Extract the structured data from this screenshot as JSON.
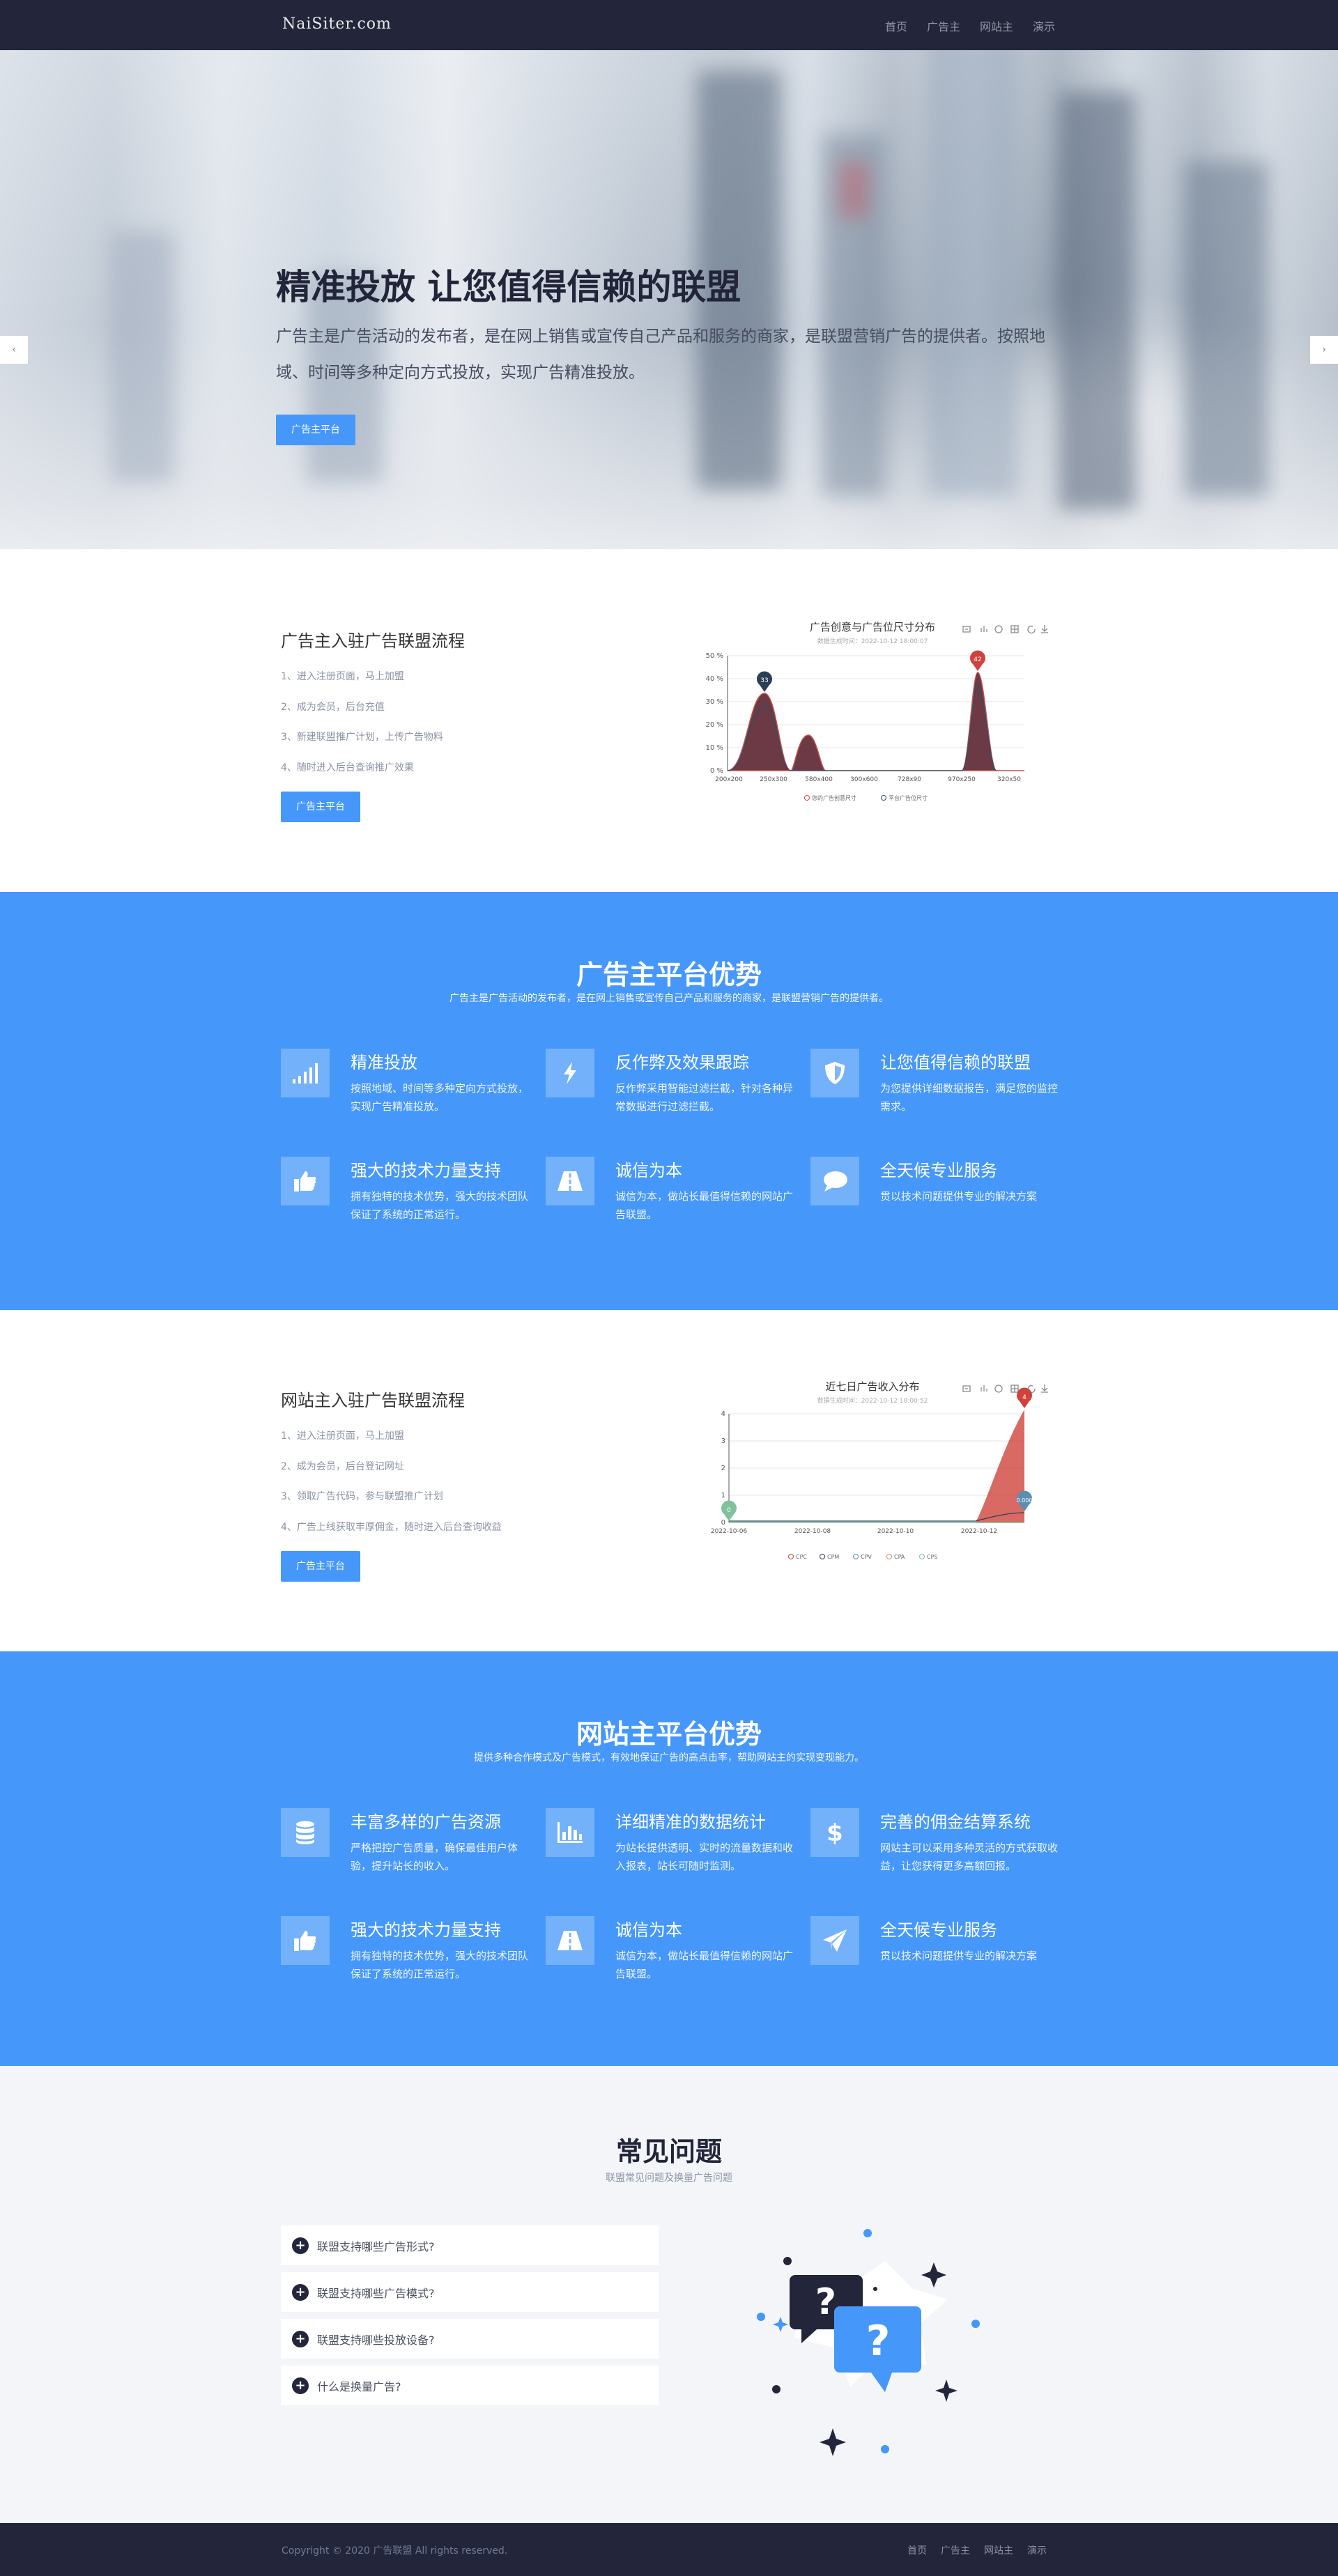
{
  "header": {
    "logo": "NaiSiter.com",
    "nav": [
      "首页",
      "广告主",
      "网站主",
      "演示"
    ]
  },
  "hero": {
    "title": "精准投放 让您值得信赖的联盟",
    "subtitle": "广告主是广告活动的发布者，是在网上销售或宣传自己产品和服务的商家，是联盟营销广告的提供者。按照地域、时间等多种定向方式投放，实现广告精准投放。",
    "button": "广告主平台",
    "prev_arrow": "‹",
    "next_arrow": "›",
    "slides": 4,
    "active_slide": 1
  },
  "advertiser_flow": {
    "title": "广告主入驻广告联盟流程",
    "steps": [
      "1、进入注册页面，马上加盟",
      "2、成为会员，后台充值",
      "3、新建联盟推广计划，上传广告物料",
      "4、随时进入后台查询推广效果"
    ],
    "button": "广告主平台"
  },
  "chart1": {
    "title": "广告创意与广告位尺寸分布",
    "subtitle": "数据生成时间：2022-10-12 18:00:07",
    "yticks": [
      "50 %",
      "40 %",
      "30 %",
      "20 %",
      "10 %",
      "0 %"
    ],
    "xticks": [
      "200x200",
      "250x300",
      "580x400",
      "300x600",
      "728x90",
      "970x250",
      "320x50"
    ],
    "legend": [
      "您的广告创意尺寸",
      "平台广告位尺寸"
    ],
    "markers": [
      "33",
      "42"
    ]
  },
  "advertiser_advantages": {
    "title": "广告主平台优势",
    "subtitle": "广告主是广告活动的发布者，是在网上销售或宣传自己产品和服务的商家，是联盟营销广告的提供者。",
    "items": [
      {
        "title": "精准投放",
        "text": "按照地域、时间等多种定向方式投放，实现广告精准投放。",
        "icon": "signal-bars-icon"
      },
      {
        "title": "反作弊及效果跟踪",
        "text": "反作弊采用智能过滤拦截，针对各种异常数据进行过滤拦截。",
        "icon": "lightning-icon"
      },
      {
        "title": "让您值得信赖的联盟",
        "text": "为您提供详细数据报告，满足您的监控需求。",
        "icon": "shield-icon"
      },
      {
        "title": "强大的技术力量支持",
        "text": "拥有独特的技术优势，强大的技术团队保证了系统的正常运行。",
        "icon": "thumbs-up-icon"
      },
      {
        "title": "诚信为本",
        "text": "诚信为本，做站长最值得信赖的网站广告联盟。",
        "icon": "road-icon"
      },
      {
        "title": "全天候专业服务",
        "text": "贯以技术问题提供专业的解决方案",
        "icon": "chat-bubble-icon"
      }
    ]
  },
  "publisher_flow": {
    "title": "网站主入驻广告联盟流程",
    "steps": [
      "1、进入注册页面，马上加盟",
      "2、成为会员，后台登记网址",
      "3、领取广告代码，参与联盟推广计划",
      "4、广告上线获取丰厚佣金，随时进入后台查询收益"
    ],
    "button": "广告主平台"
  },
  "chart2": {
    "title": "近七日广告收入分布",
    "subtitle": "数据生成时间：2022-10-12 18:00:52",
    "yticks": [
      "4",
      "3",
      "2",
      "1",
      "0"
    ],
    "xticks": [
      "2022-10-06",
      "2022-10-08",
      "2022-10-10",
      "2022-10-12"
    ],
    "legend": [
      "CPC",
      "CPM",
      "CPV",
      "CPA",
      "CPS"
    ],
    "markers": [
      "4",
      "0",
      "0.000"
    ]
  },
  "publisher_advantages": {
    "title": "网站主平台优势",
    "subtitle": "提供多种合作模式及广告模式，有效地保证广告的高点击率，帮助网站主的实现变现能力。",
    "items": [
      {
        "title": "丰富多样的广告资源",
        "text": "严格把控广告质量，确保最佳用户体验，提升站长的收入。",
        "icon": "database-icon"
      },
      {
        "title": "详细精准的数据统计",
        "text": "为站长提供透明、实时的流量数据和收入报表，站长可随时监测。",
        "icon": "bar-chart-icon"
      },
      {
        "title": "完善的佣金结算系统",
        "text": "网站主可以采用多种灵活的方式获取收益，让您获得更多高额回报。",
        "icon": "dollar-icon"
      },
      {
        "title": "强大的技术力量支持",
        "text": "拥有独特的技术优势，强大的技术团队保证了系统的正常运行。",
        "icon": "thumbs-up-icon"
      },
      {
        "title": "诚信为本",
        "text": "诚信为本，做站长最值得信赖的网站广告联盟。",
        "icon": "road-icon"
      },
      {
        "title": "全天候专业服务",
        "text": "贯以技术问题提供专业的解决方案",
        "icon": "paper-plane-icon"
      }
    ]
  },
  "faq": {
    "title": "常见问题",
    "subtitle": "联盟常见问题及换量广告问题",
    "questions": [
      "联盟支持哪些广告形式?",
      "联盟支持哪些广告模式?",
      "联盟支持哪些投放设备?",
      "什么是换量广告?"
    ],
    "expand_icon": "+"
  },
  "footer": {
    "copyright": "Copyright © 2020 广告联盟 All rights reserved.",
    "nav": [
      "首页",
      "广告主",
      "网站主",
      "演示"
    ]
  },
  "colors": {
    "accent": "#4597fa",
    "dark": "#23263a",
    "chart_fill": "#6b3a45",
    "chart_red": "#d0433c"
  }
}
